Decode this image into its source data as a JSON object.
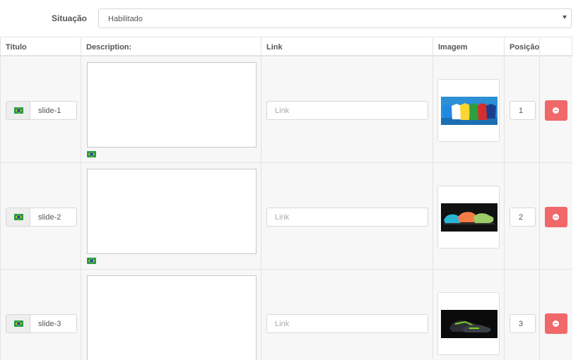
{
  "status": {
    "label": "Situação",
    "value": "Habilitado"
  },
  "columns": {
    "title": "Titulo",
    "description": "Description:",
    "link": "Link",
    "image": "Imagem",
    "position": "Posição"
  },
  "language_flag": "brazil-flag-icon",
  "rows": [
    {
      "title": "slide-1",
      "description": "",
      "link_placeholder": "Link",
      "image": "football-shirts",
      "position": "1"
    },
    {
      "title": "slide-2",
      "description": "",
      "link_placeholder": "Link",
      "image": "football-boots",
      "position": "2"
    },
    {
      "title": "slide-3",
      "description": "",
      "link_placeholder": "Link",
      "image": "football-boot-dark",
      "position": "3"
    }
  ],
  "colors": {
    "delete_button": "#f0686a",
    "row_background": "#f7f7f7",
    "border": "#e3e3e3"
  }
}
